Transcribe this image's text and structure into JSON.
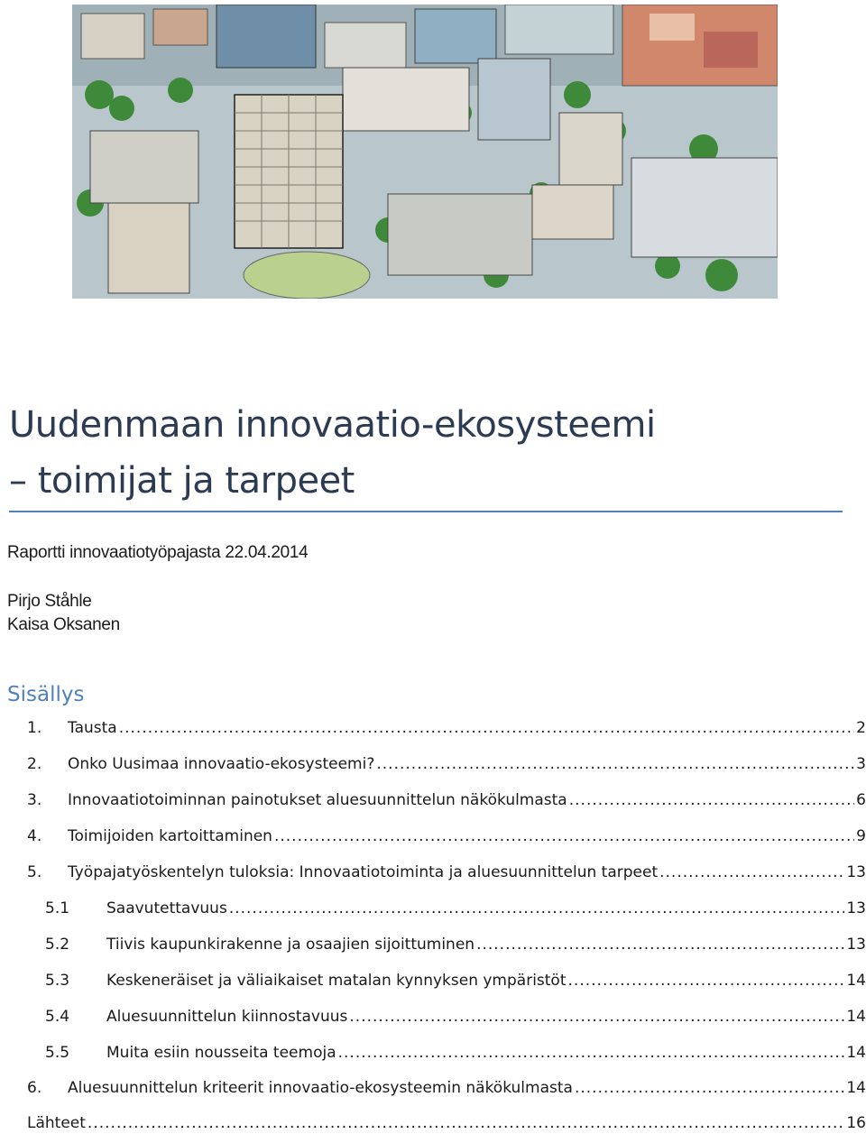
{
  "cover_image": {
    "alt": ""
  },
  "document": {
    "title_line1": "Uudenmaan innovaatio-ekosysteemi",
    "title_line2": "– toimijat ja tarpeet",
    "subtitle": "Raportti innovaatiotyöpajasta 22.04.2014",
    "authors": [
      "Pirjo Ståhle",
      "Kaisa Oksanen"
    ]
  },
  "toc": {
    "heading": "Sisällys",
    "entries": [
      {
        "num": "1.",
        "label": "Tausta",
        "page": "2"
      },
      {
        "num": "2.",
        "label": "Onko Uusimaa innovaatio-ekosysteemi?",
        "page": "3"
      },
      {
        "num": "3.",
        "label": "Innovaatiotoiminnan painotukset aluesuunnittelun näkökulmasta",
        "page": "6"
      },
      {
        "num": "4.",
        "label": "Toimijoiden kartoittaminen",
        "page": "9"
      },
      {
        "num": "5.",
        "label": "Työpajatyöskentelyn tuloksia: Innovaatiotoiminta ja aluesuunnittelun tarpeet",
        "page": "13"
      },
      {
        "num": "5.1",
        "label": "Saavutettavuus",
        "page": "13"
      },
      {
        "num": "5.2",
        "label": "Tiivis kaupunkirakenne ja osaajien sijoittuminen",
        "page": "13"
      },
      {
        "num": "5.3",
        "label": "Keskeneräiset ja väliaikaiset matalan kynnyksen ympäristöt",
        "page": "14"
      },
      {
        "num": "5.4",
        "label": "Aluesuunnittelun kiinnostavuus",
        "page": "14"
      },
      {
        "num": "5.5",
        "label": "Muita esiin nousseita teemoja",
        "page": "14"
      },
      {
        "num": "6.",
        "label": "Aluesuunnittelun kriteerit innovaatio-ekosysteemin näkökulmasta",
        "page": "14"
      },
      {
        "num": "",
        "label": "Lähteet",
        "page": "16"
      }
    ]
  }
}
